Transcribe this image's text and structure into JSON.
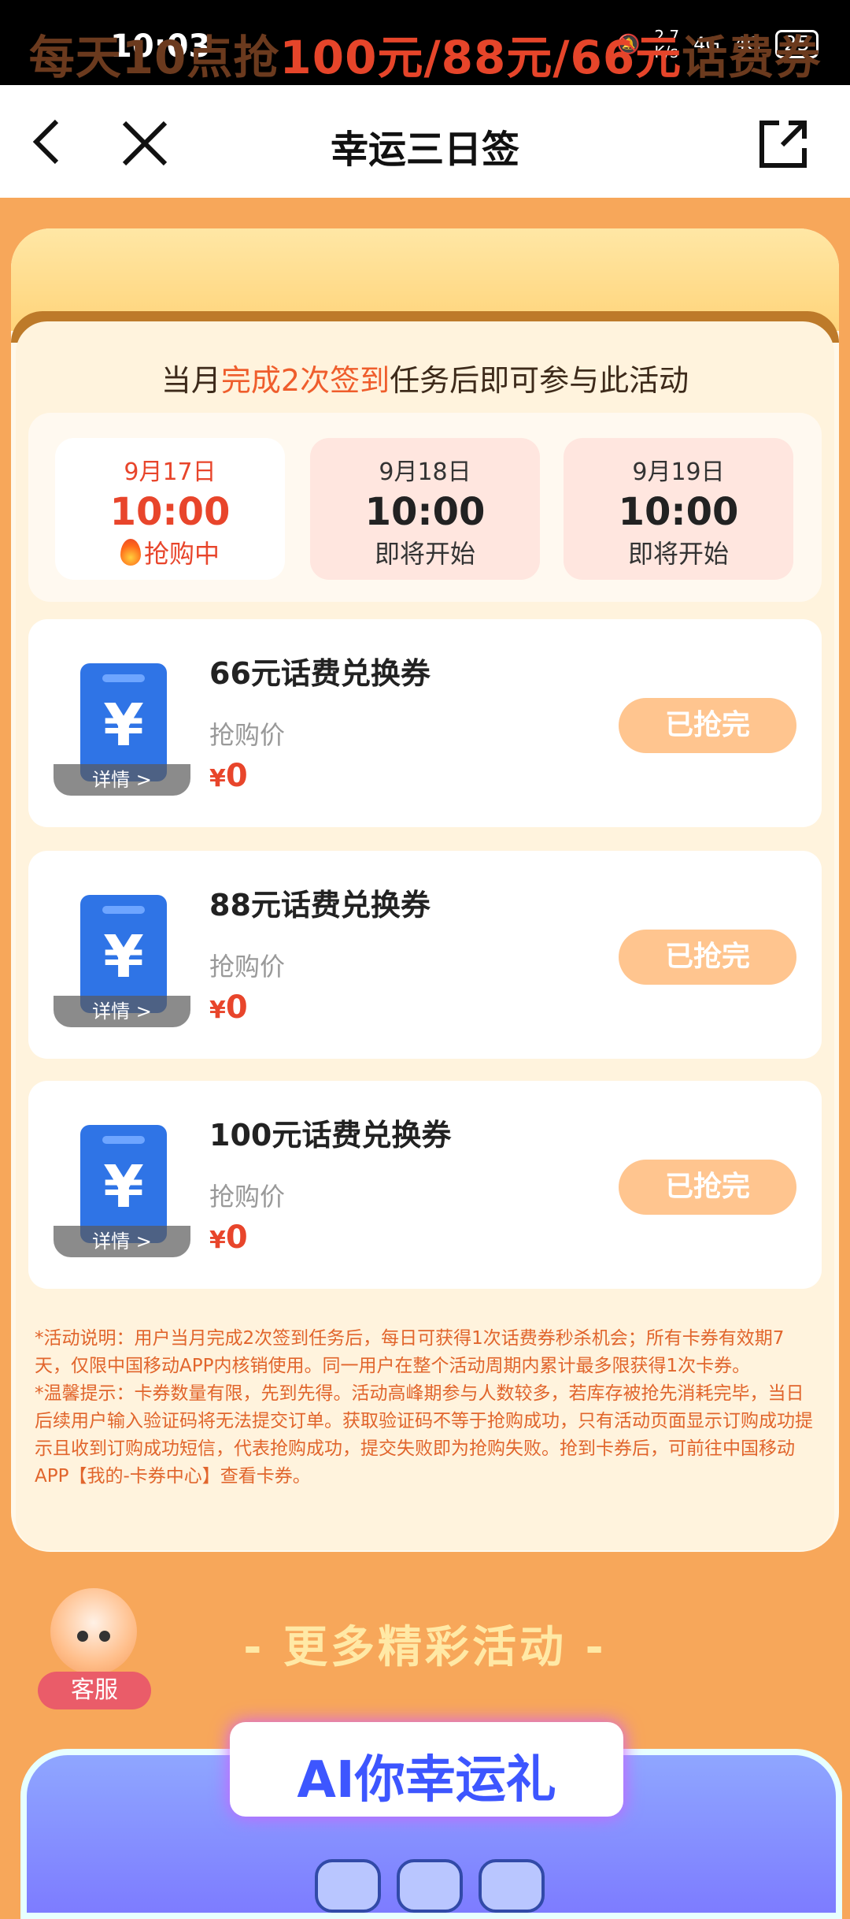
{
  "status": {
    "time": "10:03",
    "speed": "2.7\nK/s",
    "net1": "4G",
    "net2": "4G",
    "battery": "25"
  },
  "nav": {
    "title": "幸运三日签"
  },
  "banner": {
    "prefix": "每天10点抢",
    "highlight": "100元/88元/66元",
    "suffix": "话费券"
  },
  "notice": {
    "prefix": "当月",
    "highlight": "完成2次签到",
    "suffix": "任务后即可参与此活动"
  },
  "days": [
    {
      "date": "9月17日",
      "time": "10:00",
      "status": "抢购中",
      "active": true
    },
    {
      "date": "9月18日",
      "time": "10:00",
      "status": "即将开始",
      "active": false
    },
    {
      "date": "9月19日",
      "time": "10:00",
      "status": "即将开始",
      "active": false
    }
  ],
  "cards": [
    {
      "name": "66元话费兑换券",
      "detail": "详情 >",
      "price_label": "抢购价",
      "currency": "¥",
      "price": "0",
      "button": "已抢完"
    },
    {
      "name": "88元话费兑换券",
      "detail": "详情 >",
      "price_label": "抢购价",
      "currency": "¥",
      "price": "0",
      "button": "已抢完"
    },
    {
      "name": "100元话费兑换券",
      "detail": "详情 >",
      "price_label": "抢购价",
      "currency": "¥",
      "price": "0",
      "button": "已抢完"
    }
  ],
  "card_icon": "yuan-coupon-icon",
  "rules": {
    "p1": "*活动说明：用户当月完成2次签到任务后，每日可获得1次话费券秒杀机会；所有卡券有效期7天，仅限中国移动APP内核销使用。同一用户在整个活动周期内累计最多限获得1次卡券。",
    "p2": "*温馨提示：卡券数量有限，先到先得。活动高峰期参与人数较多，若库存被抢先消耗完毕，当日后续用户输入验证码将无法提交订单。获取验证码不等于抢购成功，只有活动页面显示订购成功提示且收到订购成功短信，代表抢购成功，提交失败即为抢购失败。抢到卡券后，可前往中国移动APP【我的-卡券中心】查看卡券。"
  },
  "service": {
    "label": "客服"
  },
  "more": {
    "title": "- 更多精彩活动 -"
  },
  "ai": {
    "title": "AI你幸运礼"
  },
  "colors": {
    "accent": "#e8452b",
    "sold_button": "#ffc58f",
    "background": "#f7a75a"
  }
}
